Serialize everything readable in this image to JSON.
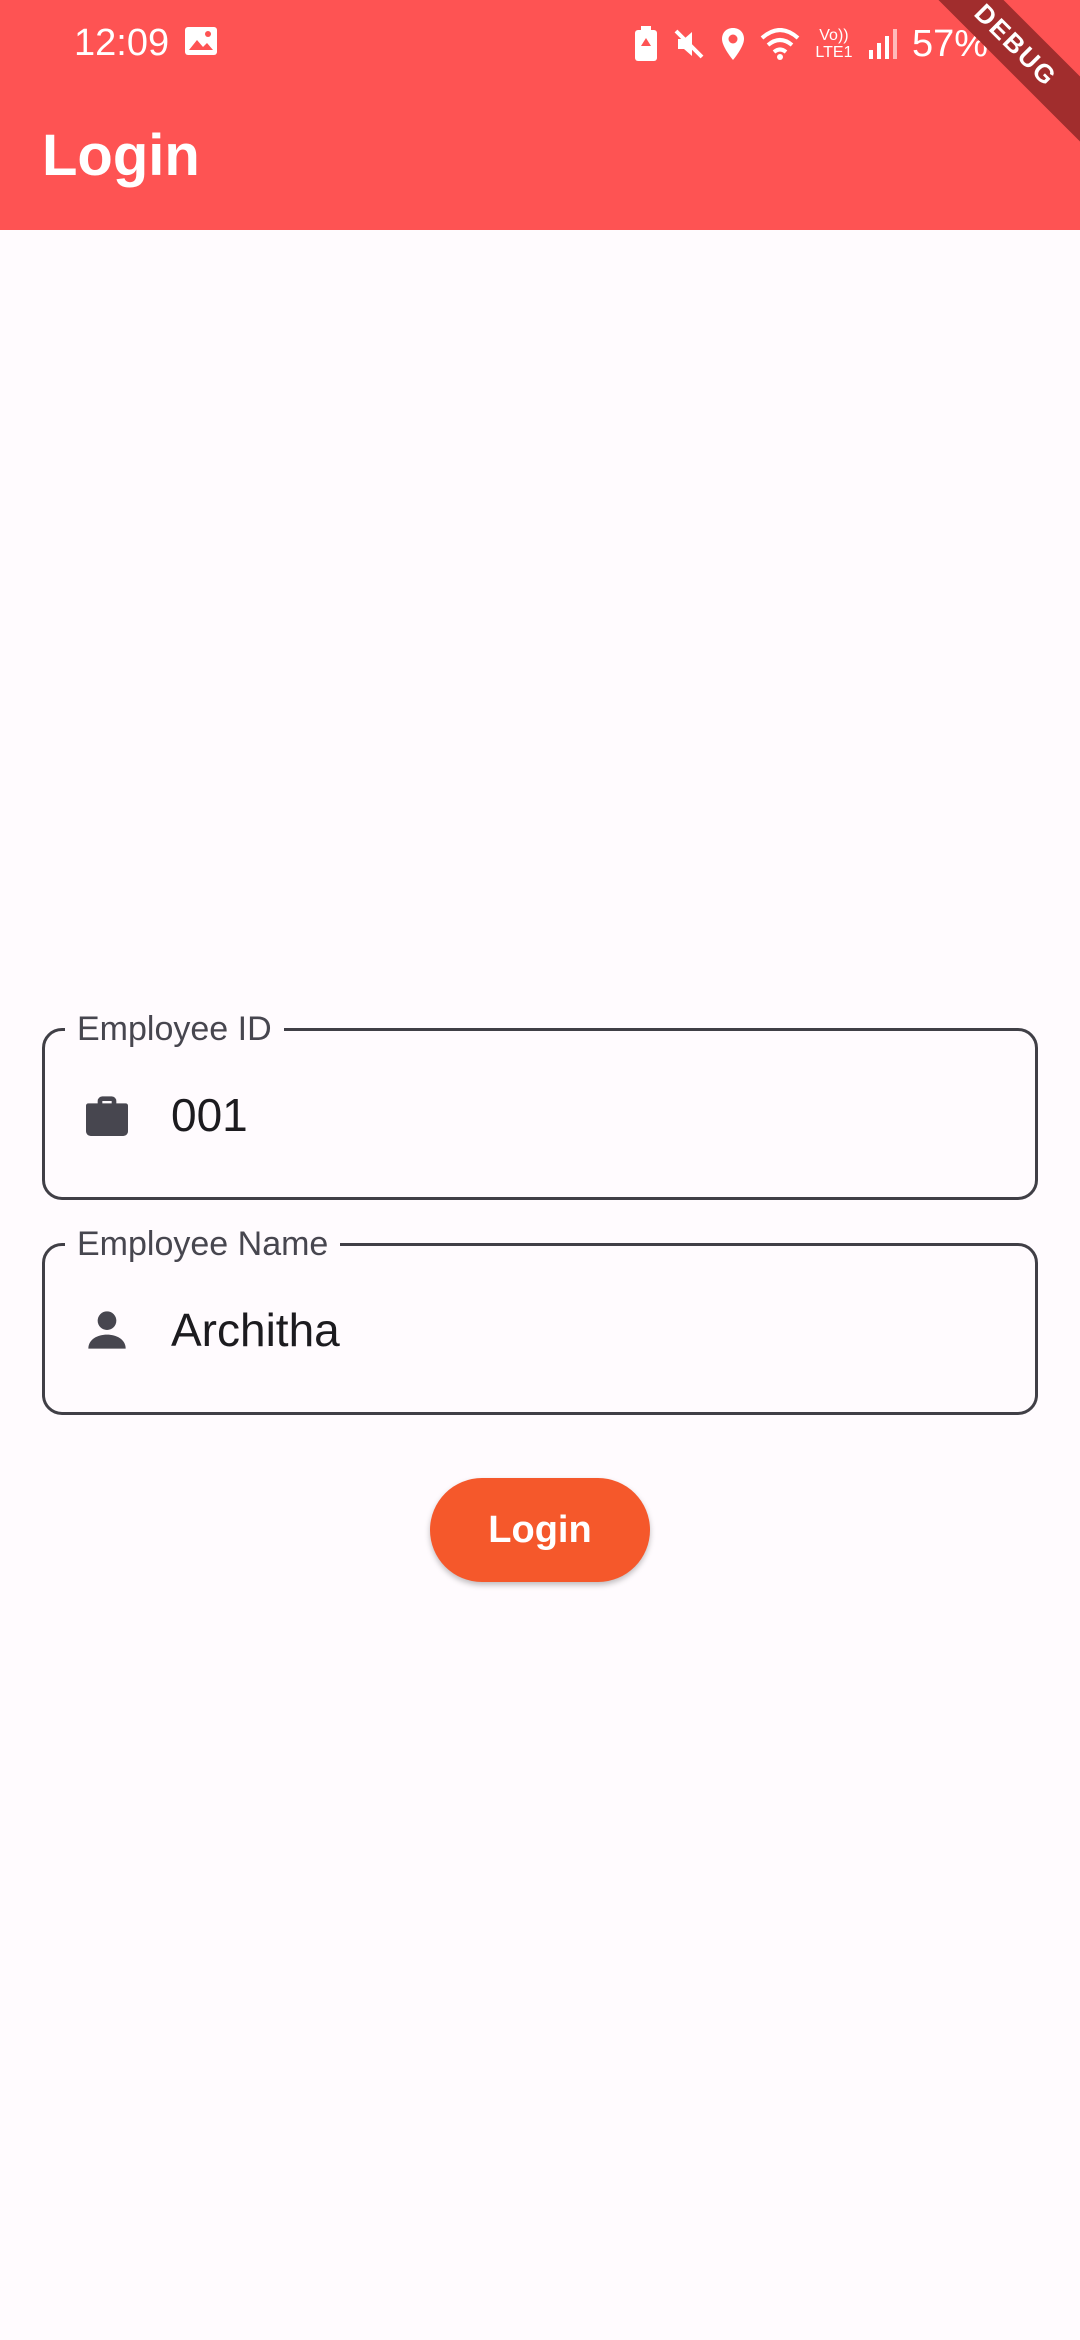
{
  "status_bar": {
    "time": "12:09",
    "battery": "57%",
    "network_label": "Vo)) LTE1"
  },
  "app_bar": {
    "title": "Login",
    "debug_banner": "DEBUG",
    "color": "#fe5353"
  },
  "form": {
    "employee_id": {
      "label": "Employee ID",
      "value": "001",
      "icon": "briefcase-icon"
    },
    "employee_name": {
      "label": "Employee Name",
      "value": "Architha",
      "icon": "person-icon"
    }
  },
  "login_button": {
    "label": "Login",
    "color": "#f5582b"
  }
}
